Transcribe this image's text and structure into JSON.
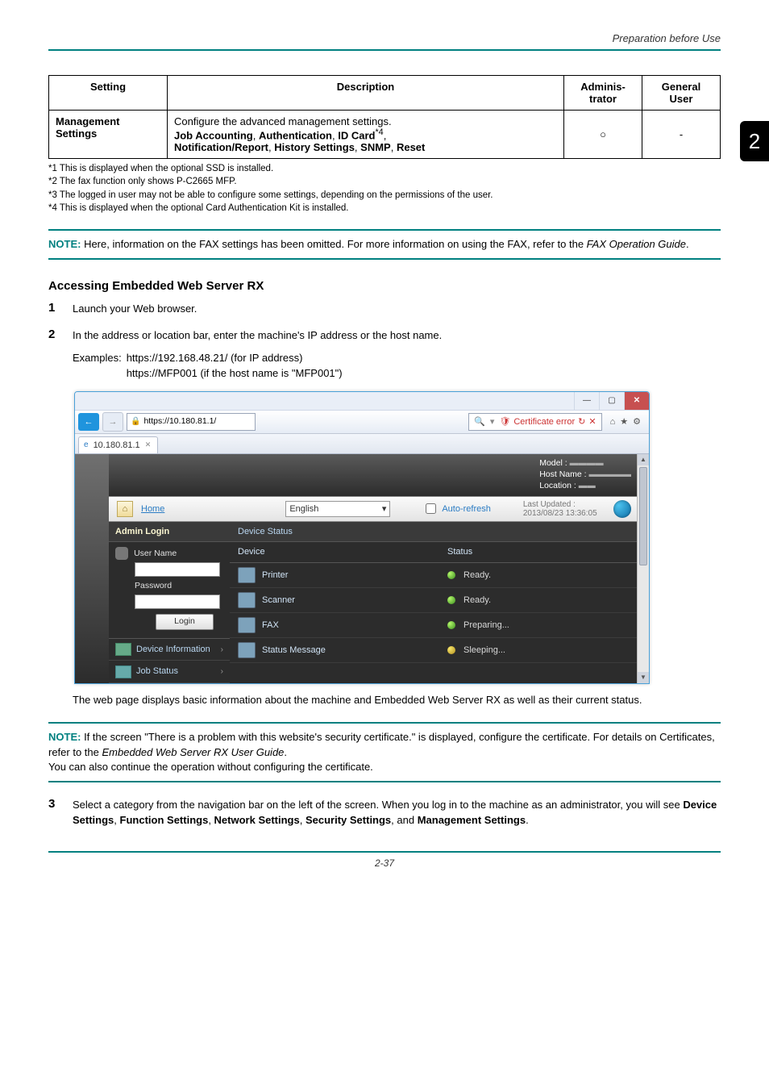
{
  "header": {
    "section_title": "Preparation before Use"
  },
  "chapter_tab": "2",
  "table": {
    "headers": {
      "setting": "Setting",
      "description": "Description",
      "admin": "Adminis-trator",
      "user": "General User"
    },
    "row": {
      "setting": "Management Settings",
      "desc_plain": "Configure the advanced management settings.",
      "desc_bold_pre": "Job Accounting",
      "desc_bold_2": "Authentication",
      "desc_bold_3": "ID Card",
      "desc_sup": "*4",
      "desc_bold_4": "Notification/Report",
      "desc_bold_5": "History Settings",
      "desc_bold_6": "SNMP",
      "desc_bold_7": "Reset",
      "admin": "○",
      "user": "-"
    }
  },
  "footnotes": {
    "f1": "*1 This is displayed when the optional SSD is installed.",
    "f2": "*2 The fax function only shows P-C2665 MFP.",
    "f3": "*3 The logged in user may not be able to configure some settings, depending on the permissions of the user.",
    "f4": "*4 This is displayed when the optional Card Authentication Kit is installed."
  },
  "note1": {
    "label": "NOTE:",
    "text_a": " Here, information on the FAX settings has been omitted. For more information on using the FAX, refer to the ",
    "italic": "FAX Operation Guide",
    "text_b": "."
  },
  "section_heading": "Accessing Embedded Web Server RX",
  "steps": {
    "s1": {
      "num": "1",
      "text": "Launch your Web browser."
    },
    "s2": {
      "num": "2",
      "text": "In the address or location bar, enter the machine's IP address or the host name.",
      "examples_label": "Examples:",
      "examples_l1": "https://192.168.48.21/ (for IP address)",
      "examples_l2": "https://MFP001 (if the host name is \"MFP001\")"
    },
    "s2_after": "The web page displays basic information about the machine and Embedded Web Server RX as well as their current status.",
    "s3": {
      "num": "3",
      "text_a": "Select a category from the navigation bar on the left of the screen. When you log in to the machine as an administrator, you will see ",
      "b1": "Device Settings",
      "c1": ", ",
      "b2": "Function Settings",
      "c2": ", ",
      "b3": "Network Settings",
      "c3": ", ",
      "b4": "Security Settings",
      "c4": ", and ",
      "b5": "Management Settings",
      "c5": "."
    }
  },
  "note2": {
    "label": "NOTE:",
    "text_a": " If the screen \"There is a problem with this website's security certificate.\" is displayed, configure the certificate. For details on Certificates, refer to the ",
    "italic": "Embedded Web Server RX User Guide",
    "text_b": ".",
    "line2": "You can also continue the operation without configuring the certificate."
  },
  "browser": {
    "url_display": "https://10.180.81.1/",
    "tab_label": "10.180.81.1",
    "search_placeholder": "",
    "cert_error": "Certificate error",
    "topband": {
      "model_lbl": "Model :",
      "host_lbl": "Host Name :",
      "loc_lbl": "Location :"
    },
    "homebar": {
      "home": "Home",
      "language": "English",
      "autorefresh": "Auto-refresh",
      "lastupdated_lbl": "Last Updated :",
      "lastupdated_val": "2013/08/23 13:36:05"
    },
    "sidebar": {
      "admin_login": "Admin Login",
      "username_lbl": "User Name",
      "password_lbl": "Password",
      "login_btn": "Login",
      "device_info": "Device Information",
      "job_status": "Job Status"
    },
    "content": {
      "device_status": "Device Status",
      "col_device": "Device",
      "col_status": "Status",
      "rows": [
        {
          "name": "Printer",
          "status": "Ready."
        },
        {
          "name": "Scanner",
          "status": "Ready."
        },
        {
          "name": "FAX",
          "status": "Preparing..."
        },
        {
          "name": "Status Message",
          "status": "Sleeping..."
        }
      ]
    }
  },
  "footer": {
    "page": "2-37"
  }
}
